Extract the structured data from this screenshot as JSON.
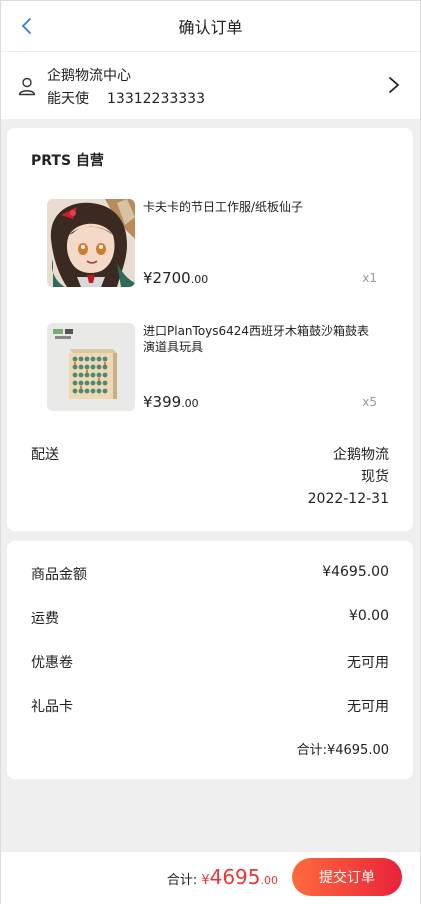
{
  "header": {
    "title": "确认订单"
  },
  "address": {
    "name_line": "企鹅物流中心",
    "recipient": "能天使",
    "phone": "13312233333"
  },
  "store": {
    "name": "PRTS 自营"
  },
  "products": [
    {
      "name": "卡夫卡的节日工作服/纸板仙子",
      "price_int": "¥2700",
      "price_dec": ".00",
      "qty": "x1"
    },
    {
      "name": "进口PlanToys6424西班牙木箱鼓沙箱鼓表演道具玩具",
      "price_int": "¥399",
      "price_dec": ".00",
      "qty": "x5"
    }
  ],
  "shipping": {
    "label": "配送",
    "carrier": "企鹅物流",
    "stock": "现货",
    "date": "2022-12-31"
  },
  "summary": {
    "rows": [
      {
        "label": "商品金额",
        "value": "¥4695.00"
      },
      {
        "label": "运费",
        "value": "¥0.00"
      },
      {
        "label": "优惠卷",
        "value": "无可用"
      },
      {
        "label": "礼品卡",
        "value": "无可用"
      }
    ],
    "total_line": "合计:¥4695.00"
  },
  "footer": {
    "total_label": "合计:",
    "currency": "¥",
    "total_int": "4695",
    "total_dec": ".00",
    "submit_label": "提交订单"
  },
  "colors": {
    "accent": "#e63838",
    "button_start": "#ff6a3d",
    "button_end": "#e8233a"
  }
}
